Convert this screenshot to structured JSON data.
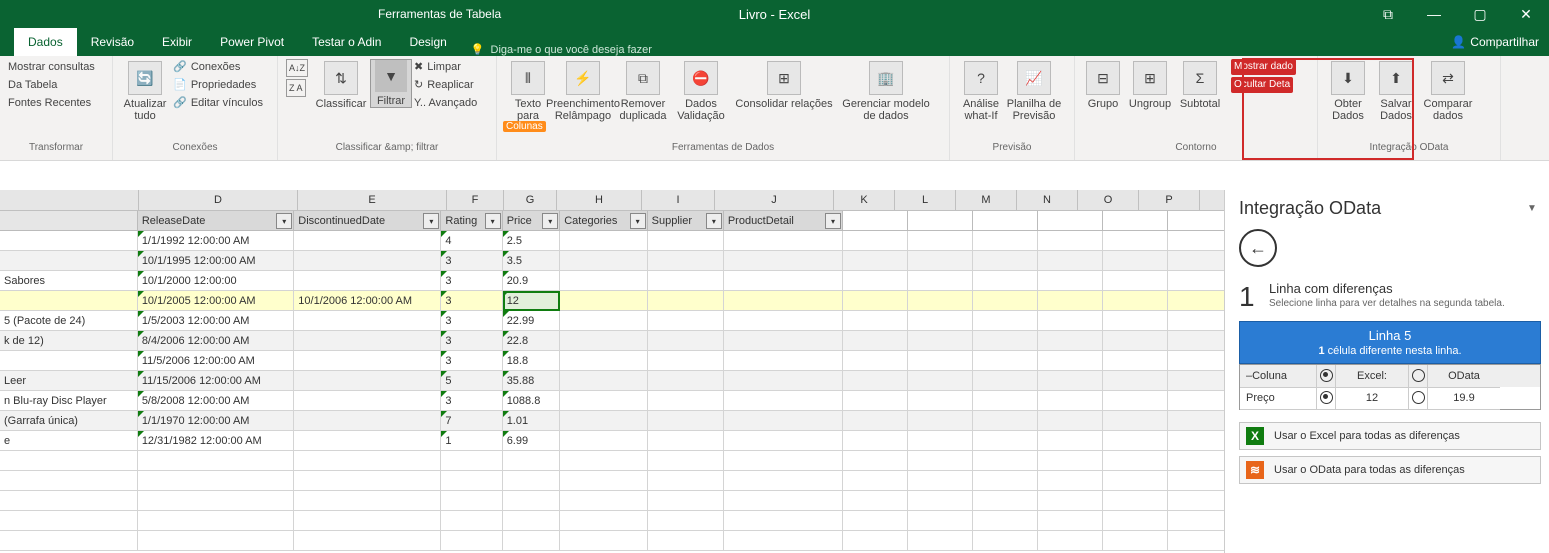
{
  "title": {
    "tool_tab": "Ferramentas de Tabela",
    "doc": "Livro - Excel"
  },
  "win": {
    "opts": "⧉",
    "min": "—",
    "max": "▢",
    "close": "✕"
  },
  "tabs": {
    "dados": "Dados",
    "revisao": "Revisão",
    "exibir": "Exibir",
    "powerpivot": "Power Pivot",
    "testar": "Testar o Adin",
    "design": "Design",
    "tell_me": "Diga-me o que você deseja fazer",
    "share": "Compartilhar"
  },
  "ribbon": {
    "g1": {
      "mostrar": "Mostrar consultas",
      "da_tabela": "Da Tabela",
      "fontes": "Fontes Recentes",
      "transformar": "Transformar"
    },
    "g2": {
      "atualizar": "Atualizar tudo",
      "conexoes": "Conexões",
      "propriedades": "Propriedades",
      "editar": "Editar vínculos",
      "label": "Conexões"
    },
    "g3": {
      "za": "Z A",
      "classificar": "Classificar",
      "filtrar": "Filtrar",
      "limpar": "Limpar",
      "replicar": "Reaplicar",
      "y_avanc": "Y.. Avançado",
      "label": "Classificar &amp; filtrar"
    },
    "g4": {
      "texto": "Texto para column",
      "preench": "Preenchimento Relâmpago",
      "colunas_tag": "Colunas",
      "remover": "Remover duplicada",
      "dados_valid": "Dados Validação",
      "consolidar": "Consolidar relações",
      "gerenciar": "Gerenciar modelo de dados",
      "label": "Ferramentas de Dados"
    },
    "g5": {
      "analise": "Análise what-If",
      "planilha": "Planilha de Previsão",
      "label": "Previsão"
    },
    "g6": {
      "grupo": "Grupo",
      "ungroup": "Ungroup",
      "subtotal": "Subtotal",
      "mostrar": "Mostrar dado",
      "ocultar": "Ocultar Deta",
      "label": "Contorno"
    },
    "g7": {
      "obter": "Obter Dados",
      "salvar": "Salvar Dados",
      "comparar": "Comparar dados",
      "label": "Integração OData"
    }
  },
  "cols": [
    "D",
    "E",
    "F",
    "G",
    "H",
    "I",
    "J",
    "K",
    "L",
    "M",
    "N",
    "O",
    "P"
  ],
  "headers": {
    "release": "ReleaseDate",
    "discont": "DiscontinuedDate",
    "rating": "Rating",
    "price": "Price",
    "categories": "Categories",
    "supplier": "Supplier",
    "detail": "ProductDetail"
  },
  "rows": [
    {
      "a": "",
      "d": "1/1/1992 12:00:00 AM",
      "e": "",
      "f": "4",
      "g": "2.5"
    },
    {
      "a": "",
      "d": "10/1/1995 12:00:00 AM",
      "e": "",
      "f": "3",
      "g": "3.5"
    },
    {
      "a": "Sabores",
      "d": "10/1/2000 12:00:00",
      "e": "",
      "f": "3",
      "g": "20.9"
    },
    {
      "a": "",
      "d": "10/1/2005 12:00:00 AM",
      "e": "10/1/2006 12:00:00 AM",
      "f": "3",
      "g": "12",
      "sel": true
    },
    {
      "a": "5 (Pacote de 24)",
      "d": "1/5/2003 12:00:00 AM",
      "e": "",
      "f": "3",
      "g": "22.99"
    },
    {
      "a": "k de 12)",
      "d": "8/4/2006 12:00:00 AM",
      "e": "",
      "f": "3",
      "g": "22.8"
    },
    {
      "a": "",
      "d": "11/5/2006 12:00:00 AM",
      "e": "",
      "f": "3",
      "g": "18.8"
    },
    {
      "a": "Leer",
      "d": "11/15/2006 12:00:00 AM",
      "e": "",
      "f": "5",
      "g": "35.88"
    },
    {
      "a": "n Blu-ray Disc Player",
      "d": "5/8/2008 12:00:00 AM",
      "e": "",
      "f": "3",
      "g": "1088.8"
    },
    {
      "a": " (Garrafa única)",
      "d": "1/1/1970 12:00:00 AM",
      "e": "",
      "f": "7",
      "g": "1.01"
    },
    {
      "a": "e",
      "d": "12/31/1982 12:00:00 AM",
      "e": "",
      "f": "1",
      "g": "6.99"
    }
  ],
  "panel": {
    "title": "Integração OData",
    "step_num": "1",
    "step_t1": "Linha com diferenças",
    "step_t2": "Selecione linha para ver detalhes na segunda tabela.",
    "blue_l1": "Linha 5",
    "blue_l2_pre": "1",
    "blue_l2": " célula diferente nesta linha.",
    "grid": {
      "h_col": "–Coluna",
      "h_excel": "Excel:",
      "h_odata": "OData",
      "r_col": "Preço",
      "r_excel": "12",
      "r_odata": "19.9"
    },
    "btn_excel": "Usar o Excel para todas as diferenças",
    "btn_odata": "Usar o OData para todas as diferenças",
    "icon_excel": "X",
    "icon_odata": "≋"
  },
  "chart_data": {
    "type": "table",
    "headers": [
      "ReleaseDate",
      "DiscontinuedDate",
      "Rating",
      "Price"
    ],
    "rows": [
      [
        "1/1/1992 12:00:00 AM",
        "",
        4,
        2.5
      ],
      [
        "10/1/1995 12:00:00 AM",
        "",
        3,
        3.5
      ],
      [
        "10/1/2000 12:00:00",
        "",
        3,
        20.9
      ],
      [
        "10/1/2005 12:00:00 AM",
        "10/1/2006 12:00:00 AM",
        3,
        12
      ],
      [
        "1/5/2003 12:00:00 AM",
        "",
        3,
        22.99
      ],
      [
        "8/4/2006 12:00:00 AM",
        "",
        3,
        22.8
      ],
      [
        "11/5/2006 12:00:00 AM",
        "",
        3,
        18.8
      ],
      [
        "11/15/2006 12:00:00 AM",
        "",
        5,
        35.88
      ],
      [
        "5/8/2008 12:00:00 AM",
        "",
        3,
        1088.8
      ],
      [
        "1/1/1970 12:00:00 AM",
        "",
        7,
        1.01
      ],
      [
        "12/31/1982 12:00:00 AM",
        "",
        1,
        6.99
      ]
    ]
  }
}
